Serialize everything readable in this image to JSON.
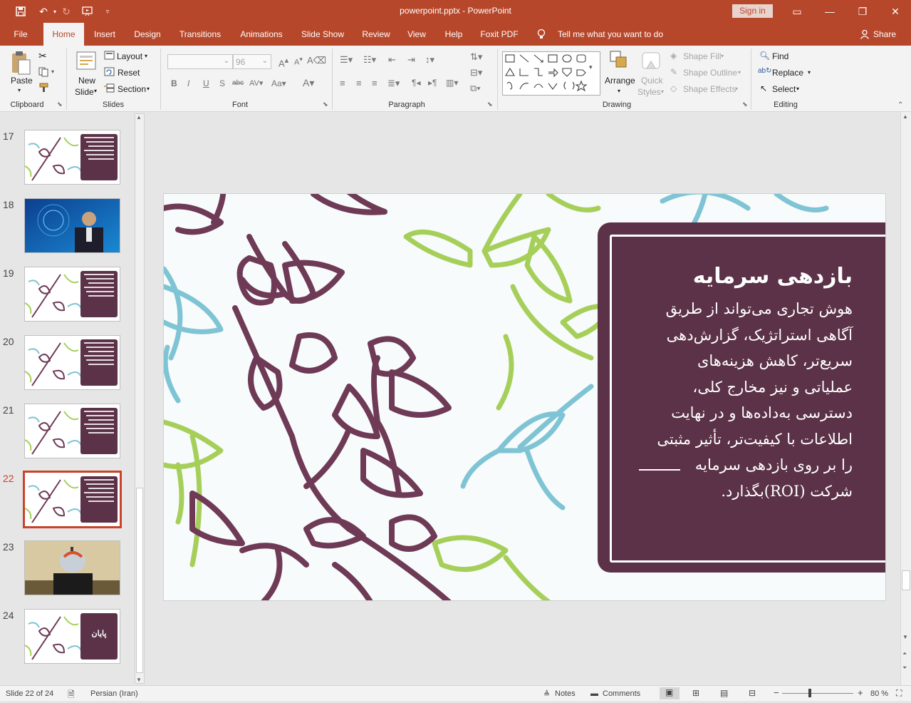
{
  "app": {
    "title": "powerpoint.pptx  -  PowerPoint",
    "sign_in": "Sign in",
    "share": "Share",
    "tell_me": "Tell me what you want to do"
  },
  "tabs": [
    "File",
    "Home",
    "Insert",
    "Design",
    "Transitions",
    "Animations",
    "Slide Show",
    "Review",
    "View",
    "Help",
    "Foxit PDF"
  ],
  "ribbon": {
    "clipboard": {
      "label": "Clipboard",
      "paste": "Paste"
    },
    "slides": {
      "label": "Slides",
      "new_slide_1": "New",
      "new_slide_2": "Slide",
      "layout": "Layout",
      "reset": "Reset",
      "section": "Section"
    },
    "font": {
      "label": "Font",
      "size": "96"
    },
    "paragraph": {
      "label": "Paragraph"
    },
    "drawing": {
      "label": "Drawing",
      "arrange": "Arrange",
      "quick_styles_1": "Quick",
      "quick_styles_2": "Styles",
      "shape_fill": "Shape Fill",
      "shape_outline": "Shape Outline",
      "shape_effects": "Shape Effects"
    },
    "editing": {
      "label": "Editing",
      "find": "Find",
      "replace": "Replace",
      "select": "Select"
    }
  },
  "thumbnails": [
    {
      "num": "17",
      "kind": "floral"
    },
    {
      "num": "18",
      "kind": "photo-business"
    },
    {
      "num": "19",
      "kind": "floral"
    },
    {
      "num": "20",
      "kind": "floral"
    },
    {
      "num": "21",
      "kind": "floral"
    },
    {
      "num": "22",
      "kind": "floral",
      "selected": true
    },
    {
      "num": "23",
      "kind": "photo-apple"
    },
    {
      "num": "24",
      "kind": "floral",
      "title": "پایان"
    }
  ],
  "slide": {
    "title": "بازدهی سرمایه",
    "body_lines": [
      "هوش تجاری می‌تواند از طریق",
      "آگاهی استراتژیک، گزارش‌دهی",
      "سریع‌تر، کاهش هزینه‌های",
      "عملیاتی و نیز مخارج کلی،",
      "دسترسی به‌داده‌ها و در نهایت",
      "اطلاعات با کیفیت‌تر، تأثیر مثبتی",
      "را بر روی بازدهی سرمایه",
      "شرکت (ROI)بگذارد."
    ],
    "colors": {
      "panel": "#5b3247",
      "purple": "#6e3a55",
      "green": "#a6cf5a",
      "blue": "#7fc4d4"
    }
  },
  "status": {
    "slide_info": "Slide 22 of 24",
    "language": "Persian (Iran)",
    "notes": "Notes",
    "comments": "Comments",
    "zoom": "80 %",
    "zoom_minus": "−",
    "zoom_plus": "+"
  }
}
